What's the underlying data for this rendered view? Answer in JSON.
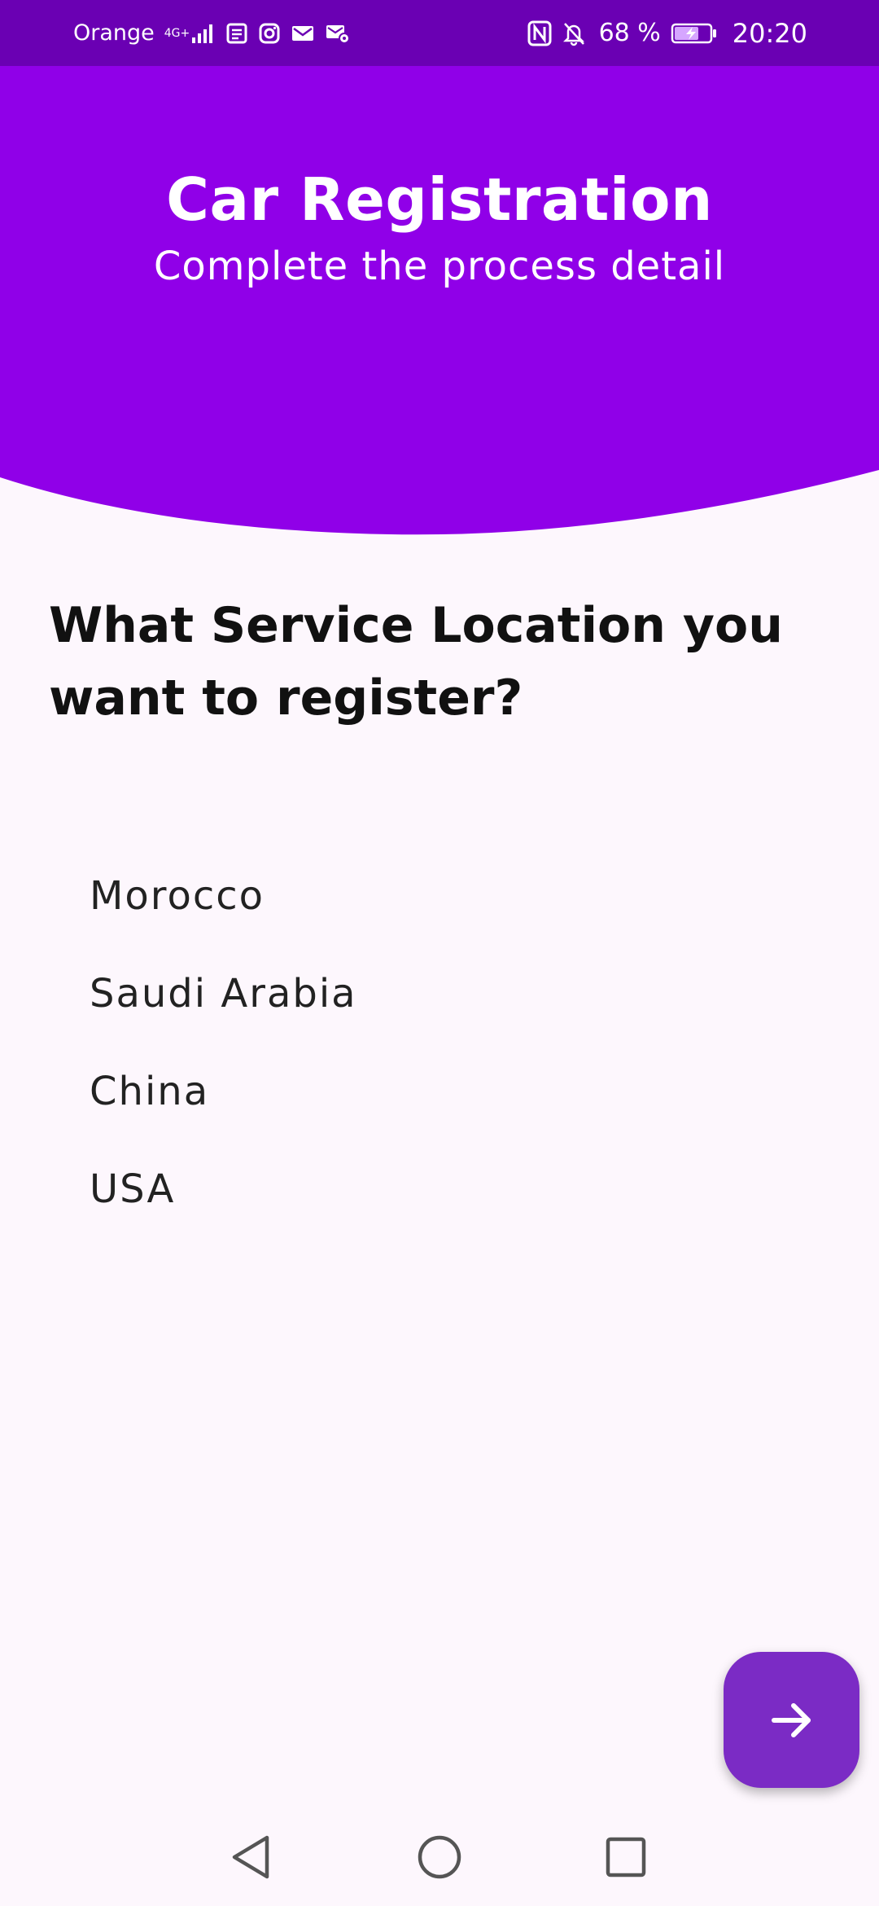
{
  "status_bar": {
    "carrier": "Orange",
    "network": "4G+",
    "battery_percent": "68 %",
    "time": "20:20",
    "icons": [
      "signal-icon",
      "news-icon",
      "instagram-icon",
      "mail-icon",
      "mail-settings-icon",
      "nfc-icon",
      "bell-muted-icon",
      "battery-charging-icon"
    ]
  },
  "header": {
    "title": "Car Registration",
    "subtitle": "Complete the process detail",
    "background_color": "#9000e8"
  },
  "question": {
    "text": "What Service Location you want to register?"
  },
  "options": [
    {
      "label": "Morocco"
    },
    {
      "label": "Saudi Arabia"
    },
    {
      "label": "China"
    },
    {
      "label": "USA"
    }
  ],
  "fab": {
    "icon": "arrow-right-icon",
    "color": "#7b2bc5"
  },
  "nav_bar": {
    "buttons": [
      "back-icon",
      "home-icon",
      "recents-icon"
    ]
  }
}
